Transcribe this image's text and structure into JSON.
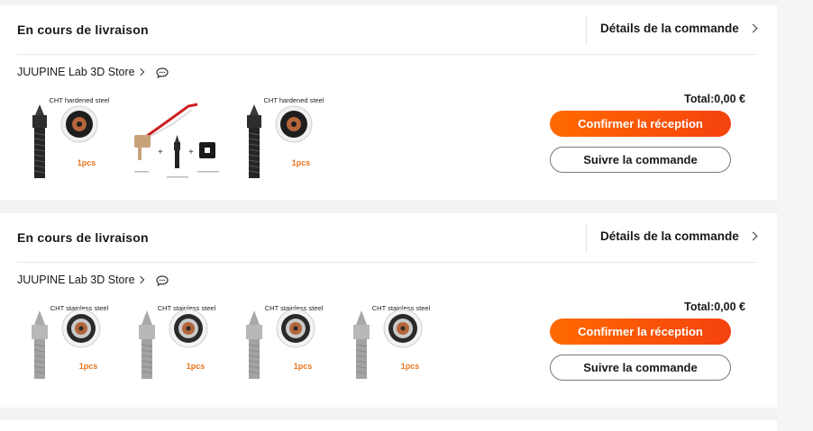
{
  "orders": [
    {
      "status": "En cours de livraison",
      "details_label": "Détails de la commande",
      "store_name": "JUUPINE Lab 3D Store",
      "total": "Total:0,00 €",
      "confirm_label": "Confirmer la réception",
      "track_label": "Suivre la commande",
      "items": [
        {
          "kind": "hardened",
          "caption": "CHT hardened steel",
          "qty": "1pcs"
        },
        {
          "kind": "kit",
          "caption": "",
          "qty": ""
        },
        {
          "kind": "hardened",
          "caption": "CHT hardened steel",
          "qty": "1pcs"
        }
      ]
    },
    {
      "status": "En cours de livraison",
      "details_label": "Détails de la commande",
      "store_name": "JUUPINE Lab 3D Store",
      "total": "Total:0,00 €",
      "confirm_label": "Confirmer la réception",
      "track_label": "Suivre la commande",
      "items": [
        {
          "kind": "stainless",
          "caption": "CHT stainless steel",
          "qty": "1pcs"
        },
        {
          "kind": "stainless",
          "caption": "CHT stainless steel",
          "qty": "1pcs"
        },
        {
          "kind": "stainless",
          "caption": "CHT stainless steel",
          "qty": "1pcs"
        },
        {
          "kind": "stainless",
          "caption": "CHT stainless steel",
          "qty": "1pcs"
        }
      ]
    }
  ],
  "colors": {
    "accent": "#ff5a0f",
    "qty_text": "#e8731a"
  },
  "icons": {
    "chat": "chat-bubble-icon",
    "chevron": "chevron-right-icon"
  }
}
